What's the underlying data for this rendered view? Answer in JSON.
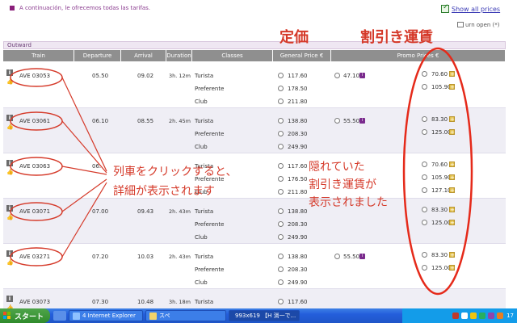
{
  "intro_text": "A continuación, le ofrecemos todas las tarifas.",
  "show_all_prices": "Show all prices",
  "return_open": "urn open (*)",
  "section_title": "Outward",
  "headers": [
    "Train",
    "Departure",
    "Arrival",
    "Duration",
    "Classes",
    "General Price €",
    "Promo Prices €"
  ],
  "trains": [
    {
      "id": "AVE 03053",
      "dep": "05.50",
      "arr": "09.02",
      "dur": "3h. 12m",
      "classes": [
        "Turista",
        "Preferente",
        "Club"
      ],
      "general": [
        "117.60",
        "178.50",
        "211.80"
      ],
      "promo_left": "47.10",
      "promo_right": [
        "70.60",
        "105.90"
      ]
    },
    {
      "id": "AVE 03061",
      "dep": "06.10",
      "arr": "08.55",
      "dur": "2h. 45m",
      "classes": [
        "Turista",
        "Preferente",
        "Club"
      ],
      "general": [
        "138.80",
        "208.30",
        "249.90"
      ],
      "promo_left": "55.50",
      "promo_right": [
        "83.30",
        "125.00"
      ]
    },
    {
      "id": "AVE 03063",
      "dep": "06.",
      "arr": "",
      "dur": "",
      "classes": [
        "Turista",
        "Preferente",
        "Club"
      ],
      "general": [
        "117.60",
        "176.50",
        "211.80"
      ],
      "promo_left": "",
      "promo_right": [
        "70.60",
        "105.90",
        "127.10"
      ]
    },
    {
      "id": "AVE 03071",
      "dep": "07.00",
      "arr": "09.43",
      "dur": "2h. 43m",
      "classes": [
        "Turista",
        "Preferente",
        "Club"
      ],
      "general": [
        "138.80",
        "208.30",
        "249.90"
      ],
      "promo_left": "",
      "promo_right": [
        "83.30",
        "125.00"
      ]
    },
    {
      "id": "AVE 03271",
      "dep": "07.20",
      "arr": "10.03",
      "dur": "2h. 43m",
      "classes": [
        "Turista",
        "Preferente",
        "Club"
      ],
      "general": [
        "138.80",
        "208.30",
        "249.90"
      ],
      "promo_left": "55.50",
      "promo_right": [
        "83.30",
        "125.00"
      ]
    },
    {
      "id": "AVE 03073",
      "dep": "07.30",
      "arr": "10.48",
      "dur": "3h. 18m",
      "classes": [
        "Turista"
      ],
      "general": [
        "117.60"
      ],
      "promo_left": "",
      "promo_right": []
    }
  ],
  "annotations": {
    "regular_price": "定価",
    "discount_fare": "割引き運賃",
    "click_train_line1": "列車をクリックすると、",
    "click_train_line2": "詳細が表示されます",
    "hidden_fare_line1": "隠れていた",
    "hidden_fare_line2": "割引き運賃が",
    "hidden_fare_line3": "表示されました"
  },
  "taskbar": {
    "start": "スタート",
    "items": [
      "4 Internet Explorer",
      "スペ",
      "993x619 【H 淌一で..."
    ],
    "tray_time": "17"
  },
  "colors": {
    "annotation_red": "#d53a2a",
    "header_gray": "#8f8f8f",
    "row_alt": "#efeef5",
    "promo_purple": "#7a2a8d"
  }
}
